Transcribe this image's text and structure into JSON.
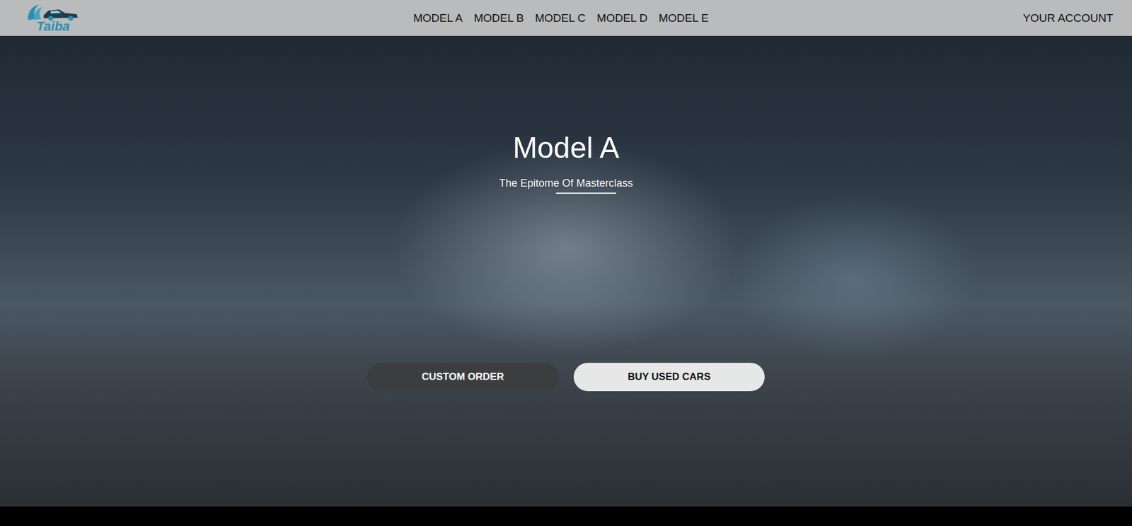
{
  "logo": {
    "text": "Taiba"
  },
  "nav": {
    "items": [
      "MODEL A",
      "MODEL B",
      "MODEL C",
      "MODEL D",
      "MODEL E"
    ],
    "account": "YOUR ACCOUNT"
  },
  "hero": {
    "title": "Model A",
    "subtitle": "The Epitome Of Masterclass",
    "buttons": [
      {
        "label": "CUSTOM ORDER",
        "kind": "dark"
      },
      {
        "label": "BUY USED CARS",
        "kind": "light"
      }
    ]
  }
}
